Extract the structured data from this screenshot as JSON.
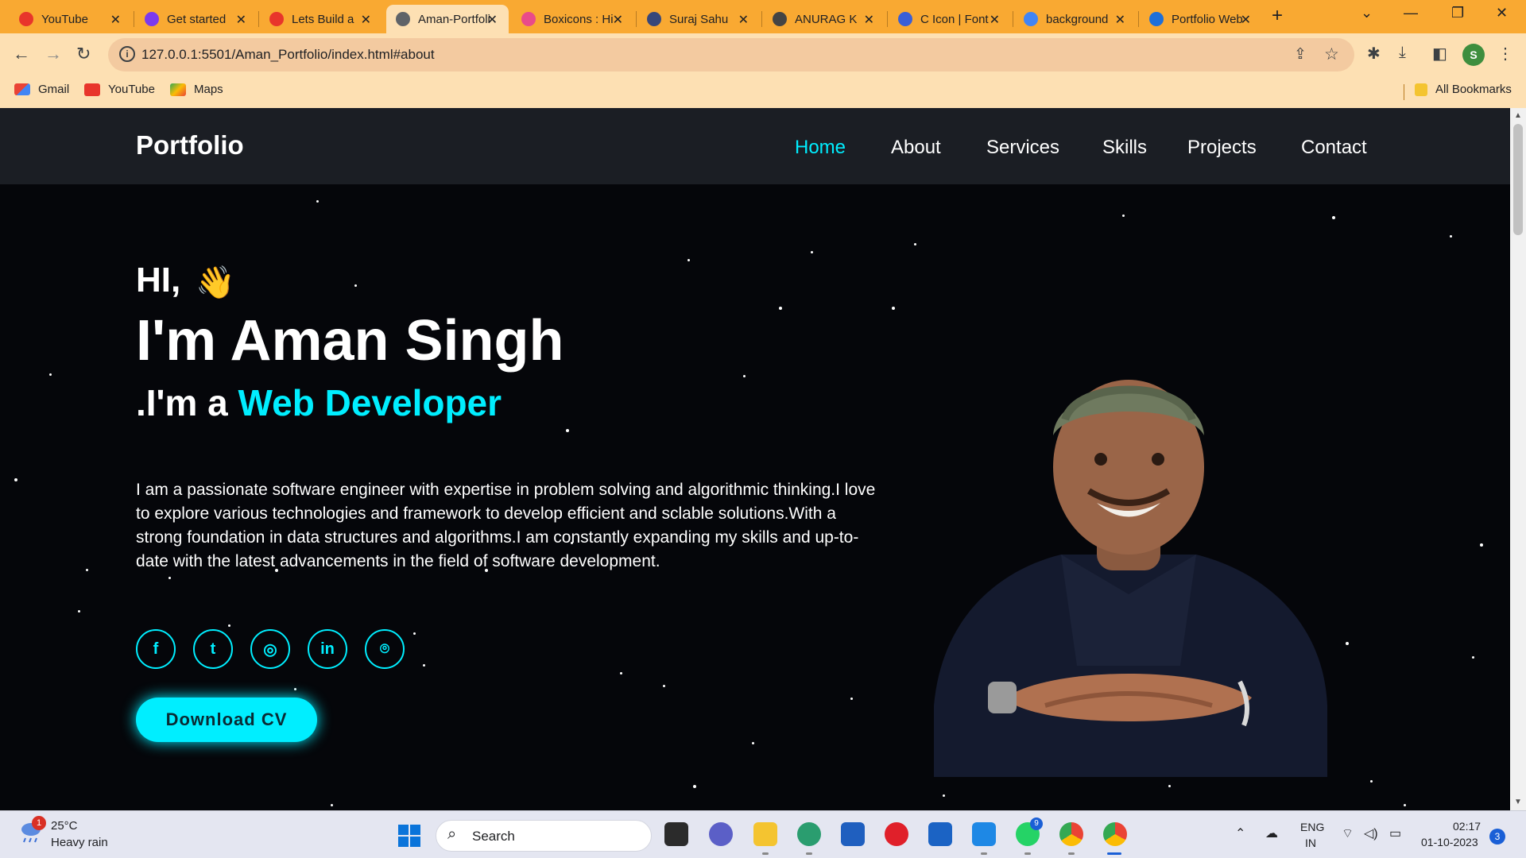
{
  "browser": {
    "tabs": [
      {
        "label": "YouTube",
        "favicon": "youtube-icon",
        "color": "#e8352b"
      },
      {
        "label": "Get started",
        "favicon": "bootstrap-icon",
        "color": "#7c3aed"
      },
      {
        "label": "Lets Build a",
        "favicon": "youtube-icon",
        "color": "#e8352b"
      },
      {
        "label": "Aman-Portfolio",
        "favicon": "globe-icon",
        "color": "#5f6368",
        "active": true
      },
      {
        "label": "Boxicons : Hi",
        "favicon": "boxicons-icon",
        "color": "#e94b8a"
      },
      {
        "label": "Suraj Sahu",
        "favicon": "avatar-icon",
        "color": "#37477a"
      },
      {
        "label": "ANURAG K",
        "favicon": "avatar-icon",
        "color": "#444"
      },
      {
        "label": "C Icon | Font",
        "favicon": "flag-icon",
        "color": "#3a5fd6"
      },
      {
        "label": "background",
        "favicon": "google-icon",
        "color": "#4285f4"
      },
      {
        "label": "Portfolio Web",
        "favicon": "w-icon",
        "color": "#1e6fd9"
      }
    ],
    "url": "127.0.0.1:5501/Aman_Portfolio/index.html#about",
    "bookmarks": [
      {
        "label": "Gmail",
        "icon": "gmail-icon"
      },
      {
        "label": "YouTube",
        "icon": "youtube-icon"
      },
      {
        "label": "Maps",
        "icon": "maps-icon"
      }
    ],
    "all_bookmarks": "All Bookmarks",
    "profile_initial": "S"
  },
  "site": {
    "logo": "Portfolio",
    "nav": [
      "Home",
      "About",
      "Services",
      "Skills",
      "Projects",
      "Contact"
    ],
    "active_nav": "Home",
    "greeting": "HI,",
    "name": "I'm Aman Singh",
    "role_prefix": ".I'm a ",
    "role": "Web Developer",
    "bio": "I am a passionate software engineer with expertise in problem solving and algorithmic thinking.I love to explore various technologies and framework to develop efficient and sclable solutions.With a strong foundation in data structures and algorithms.I am constantly expanding my skills and up-to-date with the latest advancements in the field of software development.",
    "socials": [
      "facebook-icon",
      "twitter-icon",
      "instagram-icon",
      "linkedin-icon",
      "github-icon"
    ],
    "social_glyphs": [
      "f",
      "t",
      "◎",
      "in",
      "⌾"
    ],
    "cv_button": "Download CV",
    "accent_color": "#00eeff"
  },
  "taskbar": {
    "weather_temp": "25°C",
    "weather_condition": "Heavy rain",
    "weather_badge": "1",
    "search_placeholder": "Search",
    "lang_line1": "ENG",
    "lang_line2": "IN",
    "time": "02:17",
    "date": "01-10-2023",
    "notification_count": "3",
    "whatsapp_badge": "9"
  }
}
